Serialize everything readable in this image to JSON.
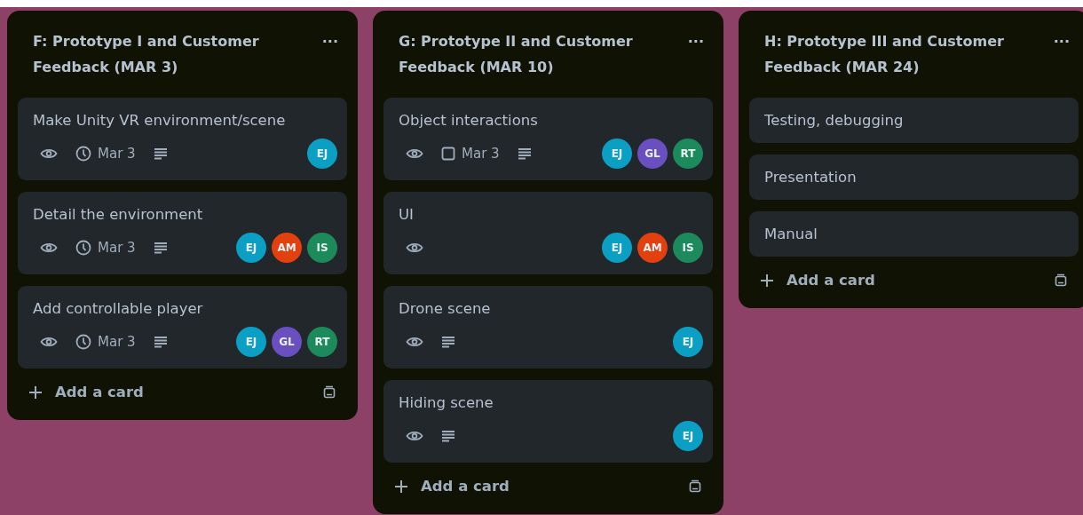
{
  "lists": [
    {
      "title": "F: Prototype I and Customer Feedback (MAR 3)",
      "menu": "···",
      "add_label": "Add a card",
      "cards": [
        {
          "title": "Make Unity VR environment/scene",
          "watching": true,
          "due": {
            "kind": "clock",
            "text": "Mar 3"
          },
          "description": true,
          "members": [
            {
              "initials": "EJ",
              "color": "#0c9fc4"
            }
          ]
        },
        {
          "title": "Detail the environment",
          "watching": true,
          "due": {
            "kind": "clock",
            "text": "Mar 3"
          },
          "description": true,
          "members": [
            {
              "initials": "EJ",
              "color": "#0c9fc4"
            },
            {
              "initials": "AM",
              "color": "#e2400f"
            },
            {
              "initials": "IS",
              "color": "#1d8a5c"
            }
          ]
        },
        {
          "title": "Add controllable player",
          "watching": true,
          "due": {
            "kind": "clock",
            "text": "Mar 3"
          },
          "description": true,
          "members": [
            {
              "initials": "EJ",
              "color": "#0c9fc4"
            },
            {
              "initials": "GL",
              "color": "#6a4fc1"
            },
            {
              "initials": "RT",
              "color": "#1d8a5c"
            }
          ]
        }
      ]
    },
    {
      "title": "G: Prototype II and Customer Feedback (MAR 10)",
      "menu": "···",
      "add_label": "Add a card",
      "cards": [
        {
          "title": "Object interactions",
          "watching": true,
          "due": {
            "kind": "checkbox",
            "text": "Mar 3"
          },
          "description": true,
          "members": [
            {
              "initials": "EJ",
              "color": "#0c9fc4"
            },
            {
              "initials": "GL",
              "color": "#6a4fc1"
            },
            {
              "initials": "RT",
              "color": "#1d8a5c"
            }
          ]
        },
        {
          "title": "UI",
          "watching": true,
          "description": false,
          "members": [
            {
              "initials": "EJ",
              "color": "#0c9fc4"
            },
            {
              "initials": "AM",
              "color": "#e2400f"
            },
            {
              "initials": "IS",
              "color": "#1d8a5c"
            }
          ]
        },
        {
          "title": "Drone scene",
          "watching": true,
          "description": true,
          "members": [
            {
              "initials": "EJ",
              "color": "#0c9fc4"
            }
          ]
        },
        {
          "title": "Hiding scene",
          "watching": true,
          "description": true,
          "members": [
            {
              "initials": "EJ",
              "color": "#0c9fc4"
            }
          ]
        }
      ]
    },
    {
      "title": "H: Prototype III and Customer Feedback (MAR 24)",
      "menu": "···",
      "add_label": "Add a card",
      "cards": [
        {
          "title": "Testing, debugging",
          "watching": false,
          "description": false
        },
        {
          "title": "Presentation",
          "watching": false,
          "description": false
        },
        {
          "title": "Manual",
          "watching": false,
          "description": false
        }
      ]
    }
  ]
}
